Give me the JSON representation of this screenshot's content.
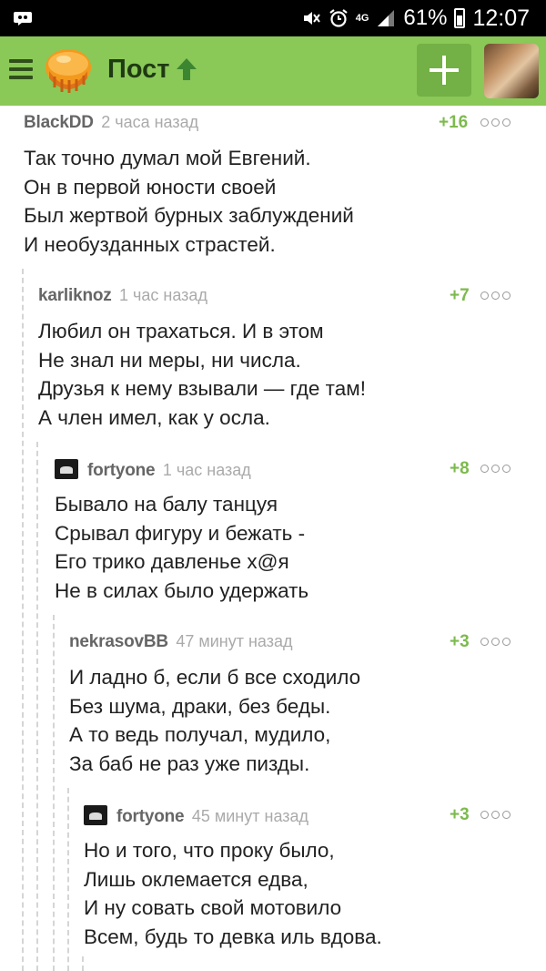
{
  "status_bar": {
    "network": "4G",
    "battery": "61%",
    "time": "12:07"
  },
  "app_bar": {
    "title": "Пост",
    "icons": [
      "menu-icon",
      "pikabu-logo",
      "rating-up-arrow-icon",
      "add-icon",
      "user-avatar"
    ]
  },
  "comments": [
    {
      "user": "BlackDD",
      "time": "2 часа назад",
      "rating": "+16",
      "has_avatar": false,
      "lines": [
        "Так точно думал мой Евгений.",
        "Он в первой юности своей",
        "Был жертвой бурных заблуждений",
        "И необузданных страстей."
      ]
    },
    {
      "user": "karliknoz",
      "time": "1 час назад",
      "rating": "+7",
      "has_avatar": false,
      "lines": [
        "Любил он трахаться. И в этом",
        "Не знал ни меры, ни числа.",
        "Друзья к нему взывали — где там!",
        "А член имел, как у осла."
      ]
    },
    {
      "user": "fortyone",
      "time": "1 час назад",
      "rating": "+8",
      "has_avatar": true,
      "lines": [
        "Бывало на балу танцуя",
        "Срывал фигуру и бежать -",
        "Его трико давленье х@я",
        "Не в силах было удержать"
      ]
    },
    {
      "user": "nekrasovBB",
      "time": "47 минут назад",
      "rating": "+3",
      "has_avatar": false,
      "lines": [
        "И ладно б, если б все сходило",
        "Без шума, драки, без беды.",
        "А то ведь получал, мудило,",
        "За баб не раз уже пизды."
      ]
    },
    {
      "user": "fortyone",
      "time": "45 минут назад",
      "rating": "+3",
      "has_avatar": true,
      "lines": [
        "Но и того, что проку было,",
        "Лишь оклемается едва,",
        "И ну совать свой мотовило",
        "Всем, будь то девка иль вдова."
      ]
    }
  ],
  "colors": {
    "app_bar": "#8ac858",
    "rating": "#7dba4e",
    "title": "#1f3a12"
  }
}
